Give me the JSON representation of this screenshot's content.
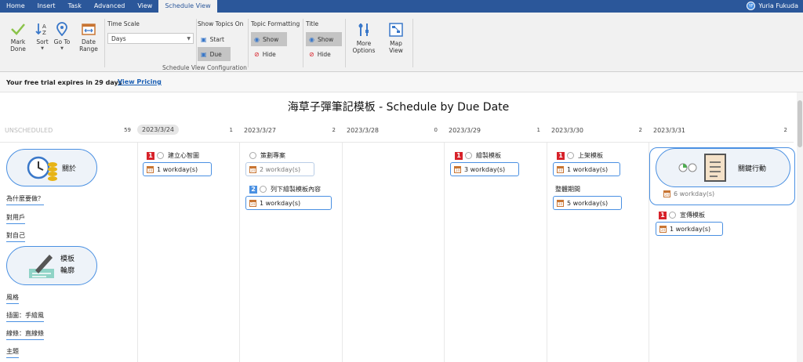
{
  "menu": {
    "tabs": [
      "Home",
      "Insert",
      "Task",
      "Advanced",
      "View",
      "Schedule View"
    ],
    "active_tab": "Schedule View",
    "user_initials": "YF",
    "user_name": "Yuria Fukuda"
  },
  "ribbon": {
    "mark_done": "Mark Done",
    "sort": "Sort",
    "go_to": "Go To",
    "date_range": "Date Range",
    "time_scale_label": "Time Scale",
    "time_scale_value": "Days",
    "show_topics_on_label": "Show Topics On",
    "start": "Start",
    "due": "Due",
    "topic_formatting_label": "Topic Formatting",
    "title_label": "Title",
    "show": "Show",
    "hide": "Hide",
    "more_options": "More Options",
    "map_view": "Map View",
    "group_label": "Schedule View Configuration"
  },
  "trial": {
    "message": "Your free trial expires in 29 days",
    "link": "View Pricing"
  },
  "schedule": {
    "title": "海草子彈筆記模板 - Schedule by Due Date",
    "columns": [
      {
        "date": "UNSCHEDULED",
        "count": "59"
      },
      {
        "date": "2023/3/24",
        "count": "1"
      },
      {
        "date": "2023/3/27",
        "count": "2"
      },
      {
        "date": "2023/3/28",
        "count": "0"
      },
      {
        "date": "2023/3/29",
        "count": "1"
      },
      {
        "date": "2023/3/30",
        "count": "2"
      },
      {
        "date": "2023/3/31",
        "count": "2"
      }
    ],
    "unscheduled": {
      "card1": "關於",
      "topics1": [
        "為什麼要做？",
        "對用戶",
        "對自己"
      ],
      "card2_line1": "模板",
      "card2_line2": "輪廓",
      "topics2": [
        "風格",
        "插圖：手繪風",
        "線條：直線條",
        "主題"
      ]
    },
    "tasks": {
      "t1": {
        "priority": "1",
        "label": "建立心智圖",
        "duration": "1 workday(s)"
      },
      "t2": {
        "label": "策劃專案",
        "duration": "2 workday(s)"
      },
      "t3": {
        "priority": "2",
        "label": "列下繪製模板內容",
        "duration": "1 workday(s)"
      },
      "t4": {
        "priority": "1",
        "label": "繪製模板",
        "duration": "3 workday(s)"
      },
      "t5": {
        "priority": "1",
        "label": "上架模板",
        "duration": "1 workday(s)"
      },
      "t6": {
        "label": "整體期間",
        "duration": "5 workday(s)"
      },
      "t7": {
        "label": "關鍵行動",
        "duration": "6 workday(s)"
      },
      "t8": {
        "priority": "1",
        "label": "宣傳模板",
        "duration": "1 workday(s)"
      }
    },
    "calendar_icon_text": "24"
  }
}
